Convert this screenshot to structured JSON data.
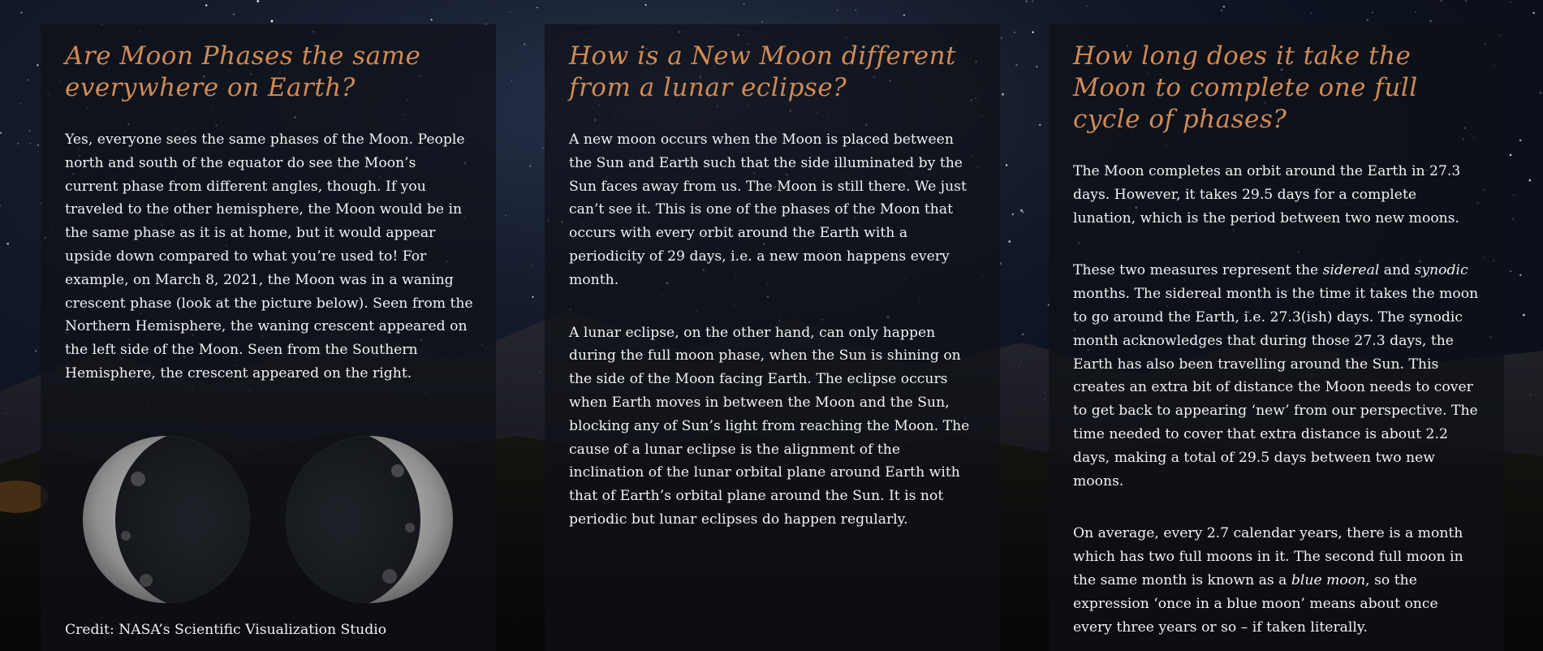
{
  "panels": [
    {
      "title": "Are Moon Phases the same everywhere on Earth?",
      "paragraphs": [
        "Yes, everyone sees the same phases of the Moon. People north and south of the equator do see the Moon’s current phase from different angles, though. If you traveled to the other hemisphere, the Moon would be in the same phase as it is at home, but it would appear upside down compared to what you’re used to! For example, on March 8, 2021, the Moon was in a waning crescent phase (look at the picture below). Seen from the Northern Hemisphere, the waning crescent appeared on the left side of the Moon. Seen from the Southern Hemisphere, the crescent appeared on the right."
      ],
      "credit": "Credit: NASA’s Scientific Visualization Studio"
    },
    {
      "title": "How is a New Moon different from a lunar eclipse?",
      "paragraphs": [
        "A new moon occurs when the Moon is placed between the Sun and Earth such that the side illuminated by the Sun faces away from us. The Moon is still there. We just can’t see it. This is one of the phases of the Moon that occurs with every orbit around the Earth with a periodicity of 29 days, i.e. a new moon happens every month.",
        "A lunar eclipse, on the other hand, can only happen during the full moon phase, when the Sun is shining on the side of the Moon facing Earth. The eclipse occurs when Earth moves in between the Moon and the Sun, blocking any of Sun’s light from reaching the Moon. The cause of a lunar eclipse is the alignment of the inclination of the lunar orbital plane around Earth with that of Earth’s orbital plane around the Sun. It is not periodic but lunar eclipses do happen regularly."
      ]
    },
    {
      "title": "How long does it take the Moon to complete one full cycle of phases?",
      "p1": "The Moon completes an orbit around the Earth in 27.3 days. However, it takes 29.5 days for a complete lunation, which is the period between two new moons.",
      "p2_a": "These two measures represent the ",
      "p2_em1": "sidereal",
      "p2_b": " and ",
      "p2_em2": "synodic",
      "p2_c": " months. The sidereal month is the time it takes the moon to go around the Earth, i.e. 27.3(ish) days. The synodic month acknowledges that during those 27.3 days, the Earth has also been travelling around the Sun. This creates an extra bit of distance the Moon needs to cover to get back to appearing ‘new’ from our perspective. The time needed to cover that extra distance is about 2.2 days, making a total of 29.5 days between two new moons.",
      "p3_a": "On average, every 2.7 calendar years, there is a month which has two full moons in it. The second full moon in the same month is known as a ",
      "p3_em": "blue moon",
      "p3_b": ", so the expression ‘once in a blue moon’ means about once every three years or so – if taken literally."
    }
  ],
  "colors": {
    "heading": "#d08a55",
    "text": "#f2f2f2",
    "panel": "rgba(14,16,22,0.72)"
  },
  "icons": {
    "moon_north": "waning-crescent-moon-northern-view",
    "moon_south": "waning-crescent-moon-southern-view"
  }
}
